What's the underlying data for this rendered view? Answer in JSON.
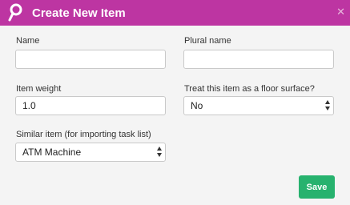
{
  "dialog": {
    "title": "Create New Item",
    "close_icon": "x-icon",
    "logo_icon": "magnifier-icon"
  },
  "form": {
    "name": {
      "label": "Name",
      "value": ""
    },
    "plural_name": {
      "label": "Plural name",
      "value": ""
    },
    "item_weight": {
      "label": "Item weight",
      "value": "1.0"
    },
    "floor_surface": {
      "label": "Treat this item as a floor surface?",
      "value": "No"
    },
    "similar_item": {
      "label": "Similar item (for importing task list)",
      "value": "ATM Machine"
    }
  },
  "actions": {
    "save_label": "Save"
  },
  "colors": {
    "header": "#bd35a2",
    "save_button": "#27b26e",
    "background": "#f4f4f4"
  }
}
